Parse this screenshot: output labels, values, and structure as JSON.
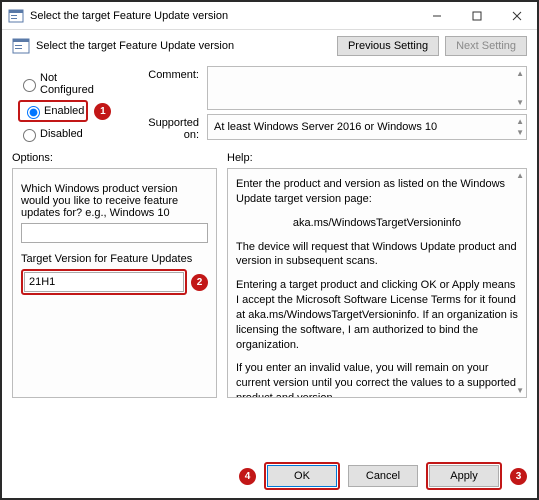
{
  "window": {
    "title": "Select the target Feature Update version"
  },
  "header": {
    "title": "Select the target Feature Update version",
    "prev": "Previous Setting",
    "next": "Next Setting"
  },
  "state": {
    "not_configured": "Not Configured",
    "enabled": "Enabled",
    "disabled": "Disabled"
  },
  "fields": {
    "comment_label": "Comment:",
    "comment_value": "",
    "supported_label": "Supported on:",
    "supported_value": "At least Windows Server 2016 or Windows 10"
  },
  "cols": {
    "options_label": "Options:",
    "help_label": "Help:"
  },
  "options": {
    "q1": "Which Windows product version would you like to receive feature updates for? e.g., Windows 10",
    "q1_value": "",
    "q2": "Target Version for Feature Updates",
    "q2_value": "21H1"
  },
  "help": {
    "p1": "Enter the product and version as listed on the Windows Update target version page:",
    "p2": "aka.ms/WindowsTargetVersioninfo",
    "p3": "The device will request that Windows Update product and version in subsequent scans.",
    "p4": "Entering a target product and clicking OK or Apply means I accept the Microsoft Software License Terms for it found at aka.ms/WindowsTargetVersioninfo. If an organization is licensing the software, I am authorized to bind the organization.",
    "p5": "If you enter an invalid value, you will remain on your current version until you correct the values to a supported product and version."
  },
  "buttons": {
    "ok": "OK",
    "cancel": "Cancel",
    "apply": "Apply"
  },
  "badges": {
    "b1": "1",
    "b2": "2",
    "b3": "3",
    "b4": "4"
  }
}
